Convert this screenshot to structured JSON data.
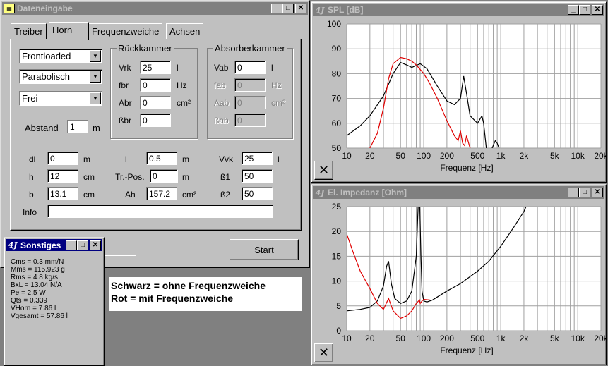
{
  "dateneingabe": {
    "title": "Dateneingabe",
    "tabs": [
      {
        "label": "Treiber"
      },
      {
        "label": "Horn"
      },
      {
        "label": "Frequenzweiche"
      },
      {
        "label": "Achsen"
      }
    ],
    "combos": {
      "type": "Frontloaded",
      "profile": "Parabolisch",
      "environment": "Frei"
    },
    "abstand": {
      "label": "Abstand",
      "value": "1",
      "unit": "m"
    },
    "rueckkammer": {
      "title": "Rückkammer",
      "rows": [
        {
          "label": "Vrk",
          "value": "25",
          "unit": "l"
        },
        {
          "label": "fbr",
          "value": "0",
          "unit": "Hz"
        },
        {
          "label": "Abr",
          "value": "0",
          "unit": "cm²"
        },
        {
          "label": "ßbr",
          "value": "0",
          "unit": ""
        }
      ]
    },
    "absorberkammer": {
      "title": "Absorberkammer",
      "rows": [
        {
          "label": "Vab",
          "value": "0",
          "unit": "l"
        },
        {
          "label": "fab",
          "value": "0",
          "unit": "Hz"
        },
        {
          "label": "Aab",
          "value": "0",
          "unit": "cm²"
        },
        {
          "label": "ßab",
          "value": "0",
          "unit": ""
        }
      ]
    },
    "params": [
      [
        {
          "label": "dl",
          "value": "0",
          "unit": "m"
        },
        {
          "label": "l",
          "value": "0.5",
          "unit": "m"
        },
        {
          "label": "Vvk",
          "value": "25",
          "unit": "l"
        }
      ],
      [
        {
          "label": "h",
          "value": "12",
          "unit": "cm"
        },
        {
          "label": "Tr.-Pos.",
          "value": "0",
          "unit": "m"
        },
        {
          "label": "ß1",
          "value": "50",
          "unit": ""
        }
      ],
      [
        {
          "label": "b",
          "value": "13.1",
          "unit": "cm"
        },
        {
          "label": "Ah",
          "value": "157.2",
          "unit": "cm²"
        },
        {
          "label": "ß2",
          "value": "50",
          "unit": ""
        }
      ]
    ],
    "info": {
      "label": "Info",
      "value": ""
    },
    "start_button": "Start"
  },
  "sonstiges": {
    "title": "Sonstiges",
    "lines": [
      "Cms = 0.3 mm/N",
      "Mms = 115.923 g",
      "Rms = 4.8 kg/s",
      "BxL = 13.04 N/A",
      "Pe = 2.5 W",
      "Qts = 0.339",
      "VHorn = 7.86 l",
      "Vgesamt = 57.86 l"
    ]
  },
  "legend_note": {
    "line1": "Schwarz = ohne Frequenzweiche",
    "line2": "Rot = mit Frequenzweiche"
  },
  "colors": {
    "titlebar_active": "#000080",
    "titlebar_inactive": "#808080",
    "curve_black": "#000000",
    "curve_red": "#e00000"
  },
  "chart_data": [
    {
      "type": "line",
      "title": "SPL [dB]",
      "xlabel": "Frequenz [Hz]",
      "ylabel": "",
      "x_scale": "log",
      "xlim": [
        10,
        20000
      ],
      "ylim": [
        50,
        100
      ],
      "xtick_labels": [
        "10",
        "20",
        "50",
        "100",
        "200",
        "500",
        "1k",
        "2k",
        "5k",
        "10k",
        "20k"
      ],
      "xtick_values": [
        10,
        20,
        50,
        100,
        200,
        500,
        1000,
        2000,
        5000,
        10000,
        20000
      ],
      "ytick_labels": [
        "50",
        "60",
        "70",
        "80",
        "90",
        "100"
      ],
      "grid": true,
      "series": [
        {
          "color": "#000000",
          "x": [
            10,
            15,
            20,
            30,
            40,
            50,
            60,
            70,
            90,
            110,
            150,
            200,
            250,
            300,
            330,
            360,
            400,
            500,
            570,
            600,
            650,
            750,
            850,
            900,
            950,
            1000
          ],
          "y": [
            55,
            59,
            63,
            71,
            80,
            84.5,
            83.5,
            82.5,
            84,
            82,
            75,
            69,
            67.5,
            70,
            79,
            72,
            63,
            60,
            63,
            60,
            50,
            49,
            53,
            52,
            50,
            48
          ]
        },
        {
          "color": "#e00000",
          "x": [
            20,
            25,
            30,
            35,
            40,
            50,
            60,
            70,
            80,
            100,
            120,
            150,
            200,
            250,
            280,
            300,
            320,
            340,
            360,
            400,
            500
          ],
          "y": [
            50,
            56,
            66,
            78,
            84,
            86.5,
            86,
            85,
            83.5,
            80,
            76,
            70,
            61,
            55,
            53,
            57,
            52,
            51,
            55,
            50,
            48
          ]
        }
      ]
    },
    {
      "type": "line",
      "title": "El. Impedanz [Ohm]",
      "xlabel": "Frequenz [Hz]",
      "ylabel": "",
      "x_scale": "log",
      "xlim": [
        10,
        20000
      ],
      "ylim": [
        0,
        25
      ],
      "xtick_labels": [
        "10",
        "20",
        "50",
        "100",
        "200",
        "500",
        "1k",
        "2k",
        "5k",
        "10k",
        "20k"
      ],
      "xtick_values": [
        10,
        20,
        50,
        100,
        200,
        500,
        1000,
        2000,
        5000,
        10000,
        20000
      ],
      "ytick_labels": [
        "0",
        "5",
        "10",
        "15",
        "20",
        "25"
      ],
      "grid": true,
      "series": [
        {
          "color": "#000000",
          "x": [
            10,
            15,
            20,
            25,
            30,
            33,
            35,
            38,
            42,
            50,
            60,
            70,
            80,
            85,
            88,
            92,
            95,
            100,
            110,
            130,
            200,
            300,
            500,
            700,
            1000,
            1500,
            2000,
            2200
          ],
          "y": [
            4,
            4.3,
            4.7,
            6,
            9,
            13,
            14,
            9.5,
            6.5,
            5.5,
            6,
            8,
            15,
            26,
            28,
            15,
            8,
            6,
            5.8,
            6.2,
            8,
            9.5,
            12,
            14,
            17,
            21,
            24,
            25.5
          ]
        },
        {
          "color": "#e00000",
          "x": [
            10,
            12,
            15,
            20,
            25,
            30,
            35,
            40,
            50,
            60,
            70,
            80,
            88,
            90,
            95,
            100,
            120
          ],
          "y": [
            19.5,
            16,
            12,
            8.5,
            5.5,
            4.3,
            6.5,
            4,
            2.5,
            3,
            4,
            5.5,
            6.2,
            5.5,
            6,
            6.3,
            6.2
          ]
        }
      ]
    }
  ]
}
